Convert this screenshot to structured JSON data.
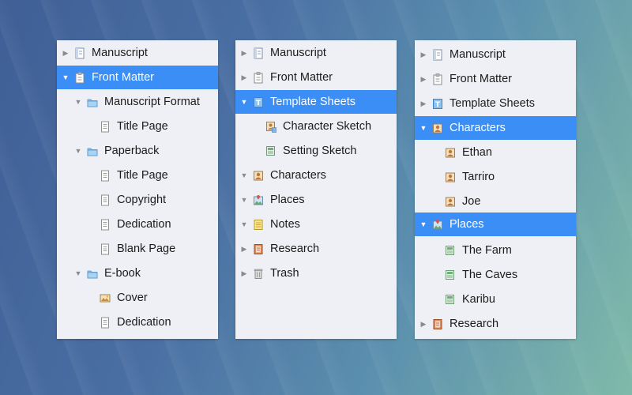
{
  "panels": [
    {
      "rows": [
        {
          "label": "Manuscript",
          "icon": "manuscript-icon",
          "arrow": "right",
          "indent": 0
        },
        {
          "label": "Front Matter",
          "icon": "clipboard-icon",
          "arrow": "down",
          "indent": 0,
          "selected": true
        },
        {
          "label": "Manuscript Format",
          "icon": "folder-icon",
          "arrow": "down",
          "indent": 1
        },
        {
          "label": "Title Page",
          "icon": "document-icon",
          "arrow": "",
          "indent": 2
        },
        {
          "label": "Paperback",
          "icon": "folder-icon",
          "arrow": "down",
          "indent": 1
        },
        {
          "label": "Title Page",
          "icon": "document-icon",
          "arrow": "",
          "indent": 2
        },
        {
          "label": "Copyright",
          "icon": "document-icon",
          "arrow": "",
          "indent": 2
        },
        {
          "label": "Dedication",
          "icon": "document-icon",
          "arrow": "",
          "indent": 2
        },
        {
          "label": "Blank Page",
          "icon": "document-icon",
          "arrow": "",
          "indent": 2
        },
        {
          "label": "E-book",
          "icon": "folder-icon",
          "arrow": "down",
          "indent": 1
        },
        {
          "label": "Cover",
          "icon": "image-icon",
          "arrow": "",
          "indent": 2
        },
        {
          "label": "Dedication",
          "icon": "document-icon",
          "arrow": "",
          "indent": 2
        }
      ]
    },
    {
      "rows": [
        {
          "label": "Manuscript",
          "icon": "manuscript-icon",
          "arrow": "right",
          "indent": 0
        },
        {
          "label": "Front Matter",
          "icon": "clipboard-icon",
          "arrow": "right",
          "indent": 0
        },
        {
          "label": "Template Sheets",
          "icon": "template-icon",
          "arrow": "down",
          "indent": 0,
          "selected": true
        },
        {
          "label": "Character Sketch",
          "icon": "character-sketch-icon",
          "arrow": "",
          "indent": 1
        },
        {
          "label": "Setting Sketch",
          "icon": "setting-sketch-icon",
          "arrow": "",
          "indent": 1
        },
        {
          "label": "Characters",
          "icon": "character-icon",
          "arrow": "down",
          "indent": 0
        },
        {
          "label": "Places",
          "icon": "places-icon",
          "arrow": "down",
          "indent": 0
        },
        {
          "label": "Notes",
          "icon": "notes-icon",
          "arrow": "down",
          "indent": 0
        },
        {
          "label": "Research",
          "icon": "research-icon",
          "arrow": "right",
          "indent": 0
        },
        {
          "label": "Trash",
          "icon": "trash-icon",
          "arrow": "right",
          "indent": 0
        }
      ]
    },
    {
      "rows": [
        {
          "label": "Manuscript",
          "icon": "manuscript-icon",
          "arrow": "right",
          "indent": 0
        },
        {
          "label": "Front Matter",
          "icon": "clipboard-icon",
          "arrow": "right",
          "indent": 0
        },
        {
          "label": "Template Sheets",
          "icon": "template-icon",
          "arrow": "right",
          "indent": 0
        },
        {
          "label": "Characters",
          "icon": "character-icon",
          "arrow": "down",
          "indent": 0,
          "selected": true
        },
        {
          "label": "Ethan",
          "icon": "character-icon",
          "arrow": "",
          "indent": 1
        },
        {
          "label": "Tarriro",
          "icon": "character-icon",
          "arrow": "",
          "indent": 1
        },
        {
          "label": "Joe",
          "icon": "character-icon",
          "arrow": "",
          "indent": 1
        },
        {
          "label": "Places",
          "icon": "places-icon",
          "arrow": "down",
          "indent": 0,
          "selected": true
        },
        {
          "label": "The Farm",
          "icon": "setting-sketch-icon",
          "arrow": "",
          "indent": 1
        },
        {
          "label": "The Caves",
          "icon": "setting-sketch-icon",
          "arrow": "",
          "indent": 1
        },
        {
          "label": "Karibu",
          "icon": "setting-sketch-icon",
          "arrow": "",
          "indent": 1
        },
        {
          "label": "Research",
          "icon": "research-icon",
          "arrow": "right",
          "indent": 0
        }
      ]
    }
  ]
}
